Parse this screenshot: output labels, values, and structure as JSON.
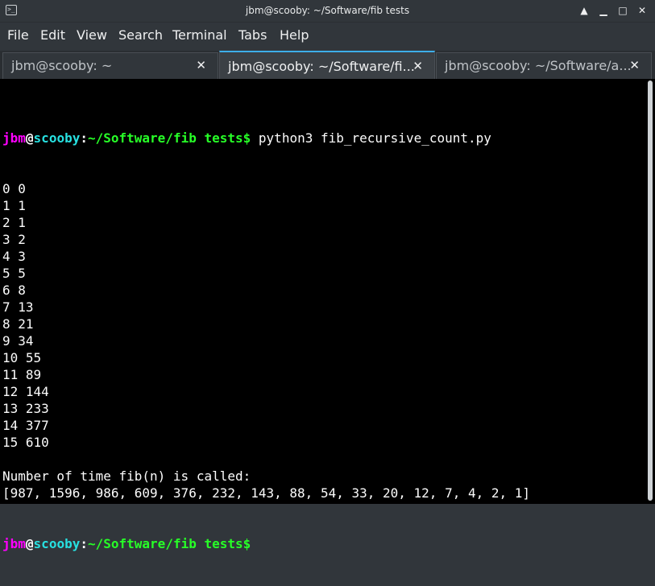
{
  "window": {
    "title": "jbm@scooby: ~/Software/fib tests",
    "minimize_glyph": "▁",
    "maximize_glyph": "□",
    "close_glyph": "✕",
    "more_glyph": "▲"
  },
  "menu": [
    "File",
    "Edit",
    "View",
    "Search",
    "Terminal",
    "Tabs",
    "Help"
  ],
  "tabs": [
    {
      "label": "jbm@scooby: ~",
      "close": "✕"
    },
    {
      "label": "jbm@scooby: ~/Software/fi...",
      "close": "✕"
    },
    {
      "label": "jbm@scooby: ~/Software/a...",
      "close": "✕"
    }
  ],
  "terminal": {
    "prompt": {
      "user": "jbm",
      "at": "@",
      "host": "scooby",
      "sep": ":",
      "path": "~/Software/fib tests",
      "symbol": "$"
    },
    "command": " python3 fib_recursive_count.py",
    "output": [
      "0 0",
      "1 1",
      "2 1",
      "3 2",
      "4 3",
      "5 5",
      "6 8",
      "7 13",
      "8 21",
      "9 34",
      "10 55",
      "11 89",
      "12 144",
      "13 233",
      "14 377",
      "15 610",
      "",
      "Number of time fib(n) is called:",
      "[987, 1596, 986, 609, 376, 232, 143, 88, 54, 33, 20, 12, 7, 4, 2, 1]"
    ]
  },
  "colors": {
    "user": "#ff00ff",
    "host": "#27e0e0",
    "path": "#27ff27",
    "accent": "#3daee9"
  }
}
